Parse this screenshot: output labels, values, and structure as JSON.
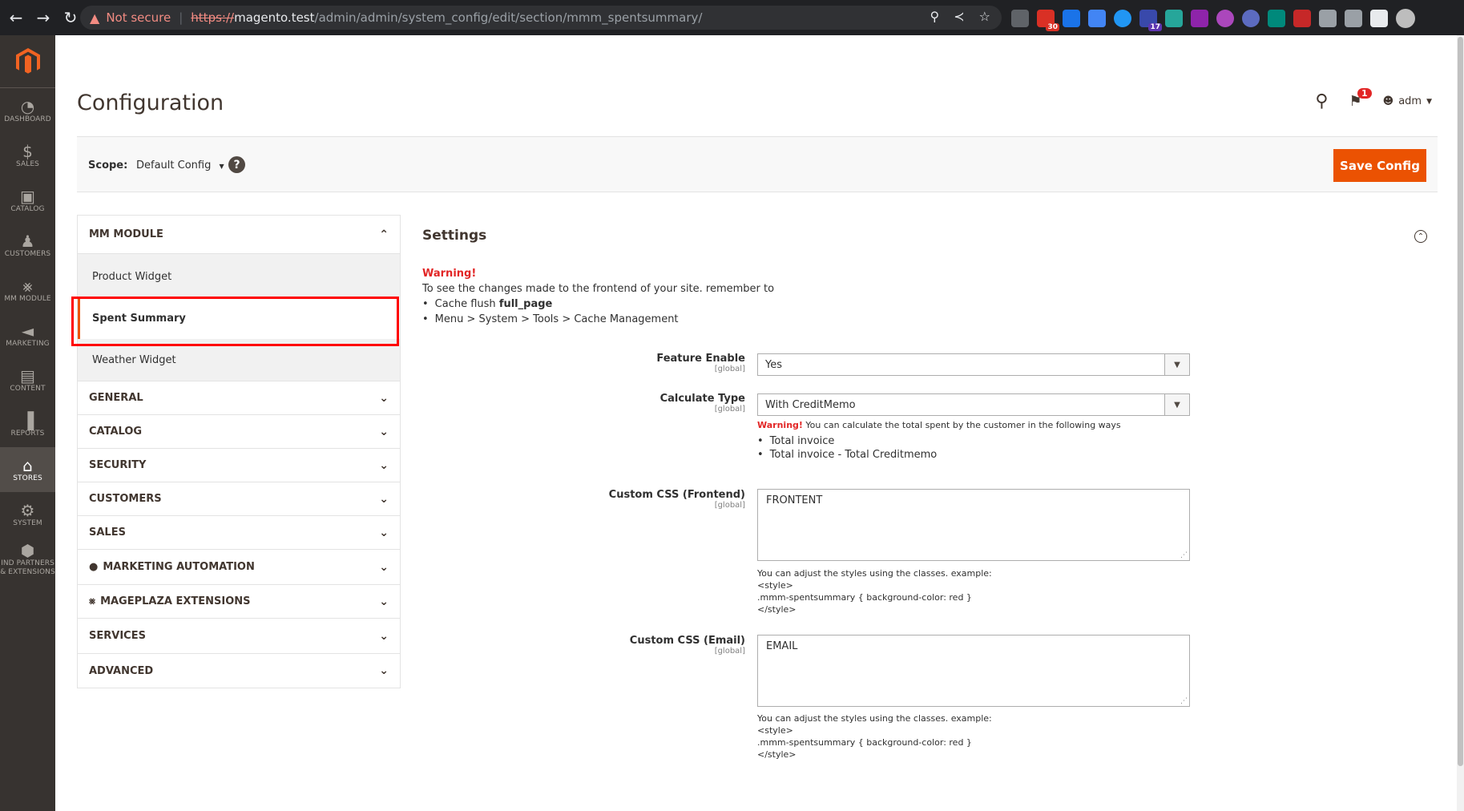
{
  "browser": {
    "security_label": "Not secure",
    "url_scheme": "https://",
    "url_host": "magento.test",
    "url_path": "/admin/admin/system_config/edit/section/mmm_spentsummary/",
    "ext_badges": [
      "30",
      "17"
    ]
  },
  "sidebar": {
    "items": [
      {
        "label": "DASHBOARD",
        "icon": "dashboard-icon"
      },
      {
        "label": "SALES",
        "icon": "dollar-icon"
      },
      {
        "label": "CATALOG",
        "icon": "box-icon"
      },
      {
        "label": "CUSTOMERS",
        "icon": "person-icon"
      },
      {
        "label": "MM MODULE",
        "icon": "mm-module-icon"
      },
      {
        "label": "MARKETING",
        "icon": "megaphone-icon"
      },
      {
        "label": "CONTENT",
        "icon": "content-icon"
      },
      {
        "label": "REPORTS",
        "icon": "bar-chart-icon"
      },
      {
        "label": "STORES",
        "icon": "store-icon",
        "active": true
      },
      {
        "label": "SYSTEM",
        "icon": "gear-icon"
      },
      {
        "label": "IND PARTNERS & EXTENSIONS",
        "icon": "cube-icon"
      }
    ]
  },
  "header": {
    "title": "Configuration",
    "notifications_count": "1",
    "user": "adm"
  },
  "scope": {
    "label": "Scope:",
    "value": "Default Config",
    "help": "?",
    "save_label": "Save Config"
  },
  "tabs": {
    "mm_module": {
      "label": "MM MODULE",
      "items": [
        "Product Widget",
        "Spent Summary",
        "Weather Widget"
      ]
    },
    "groups": [
      "GENERAL",
      "CATALOG",
      "SECURITY",
      "CUSTOMERS",
      "SALES",
      "MARKETING AUTOMATION",
      "MAGEPLAZA EXTENSIONS",
      "SERVICES",
      "ADVANCED"
    ]
  },
  "settings": {
    "title": "Settings",
    "warning_title": "Warning!",
    "warning_text": "To see the changes made to the frontend of your site. remember to",
    "warning_items": [
      "Cache flush ",
      "Menu > System > Tools > Cache Management"
    ],
    "warning_item_bold": "full_page",
    "scope_tag": "[global]",
    "feature_enable": {
      "label": "Feature Enable",
      "value": "Yes"
    },
    "calculate_type": {
      "label": "Calculate Type",
      "value": "With CreditMemo",
      "note_warn": "Warning!",
      "note_text": " You can calculate the total spent by the customer in the following ways",
      "note_items": [
        "Total invoice",
        "Total invoice - Total Creditmemo"
      ]
    },
    "custom_css_frontend": {
      "label": "Custom CSS (Frontend)",
      "value": "FRONTENT",
      "hint": [
        "You can adjust the styles using the classes. example:",
        "<style>",
        ".mmm-spentsummary { background-color: red }",
        "</style>"
      ]
    },
    "custom_css_email": {
      "label": "Custom CSS (Email)",
      "value": "EMAIL",
      "hint": [
        "You can adjust the styles using the classes. example:",
        "<style>",
        ".mmm-spentsummary { background-color: red }",
        "</style>"
      ]
    }
  }
}
